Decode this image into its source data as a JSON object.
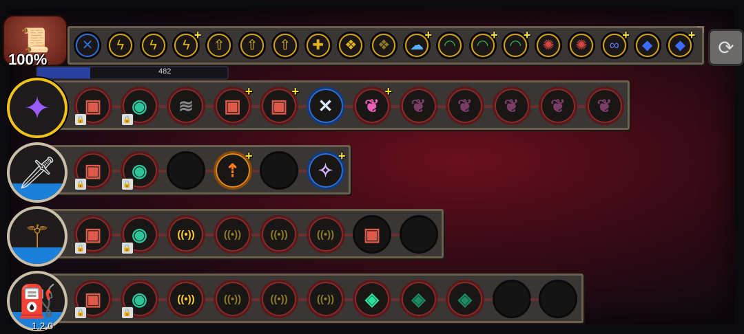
{
  "header": {
    "bag_percent": "100%",
    "xp_value": "482",
    "xp_progress": 0.28,
    "bag_icon": "scroll-bag-icon",
    "swap_icon": "refresh-icon"
  },
  "top_perks": [
    {
      "icon": "crossed-arrows-blue",
      "glyph": "✕",
      "color": "#2d6fd8",
      "plus": false
    },
    {
      "icon": "lightning-yellow",
      "glyph": "ϟ",
      "color": "#e0b31f",
      "plus": false
    },
    {
      "icon": "lightning-yellow",
      "glyph": "ϟ",
      "color": "#e0b31f",
      "plus": false
    },
    {
      "icon": "lightning-yellow-plus",
      "glyph": "ϟ",
      "color": "#e0b31f",
      "plus": true
    },
    {
      "icon": "arrow-up-yellow",
      "glyph": "⇧",
      "color": "#e0b31f",
      "plus": false
    },
    {
      "icon": "arrow-up-yellow",
      "glyph": "⇧",
      "color": "#e0b31f",
      "plus": false
    },
    {
      "icon": "arrow-up-yellow",
      "glyph": "⇧",
      "color": "#e0b31f",
      "plus": false
    },
    {
      "icon": "cross-rune-yellow",
      "glyph": "✚",
      "color": "#e0b31f",
      "plus": false
    },
    {
      "icon": "shield-rune-yellow",
      "glyph": "❖",
      "color": "#e0b31f",
      "plus": false
    },
    {
      "icon": "shield-rune-dim",
      "glyph": "❖",
      "color": "#8d7a2a",
      "plus": false
    },
    {
      "icon": "ghost-blue-plus",
      "glyph": "☁",
      "color": "#5ab3ff",
      "plus": true
    },
    {
      "icon": "green-arc",
      "glyph": "◠",
      "color": "#39c14e",
      "plus": false
    },
    {
      "icon": "green-arc-plus",
      "glyph": "◠",
      "color": "#39c14e",
      "plus": true
    },
    {
      "icon": "green-arc-plus",
      "glyph": "◠",
      "color": "#39c14e",
      "plus": true
    },
    {
      "icon": "red-swirl",
      "glyph": "✺",
      "color": "#d84646",
      "plus": false
    },
    {
      "icon": "red-swirl",
      "glyph": "✺",
      "color": "#d84646",
      "plus": false
    },
    {
      "icon": "infinity-plus",
      "glyph": "∞",
      "color": "#5d7bf0",
      "plus": true
    },
    {
      "icon": "blue-diamond",
      "glyph": "◆",
      "color": "#3b6cff",
      "plus": false
    },
    {
      "icon": "blue-diamond-plus",
      "glyph": "◆",
      "color": "#3b6cff",
      "plus": true
    }
  ],
  "weapons": [
    {
      "name": "crystal-weapon",
      "icon_glyph": "✦",
      "icon_color": "#9a5cff",
      "selected": true,
      "water": false,
      "slots": [
        {
          "icon": "red-box-locked",
          "glyph": "▣",
          "color": "#e05a4a",
          "ring": "red",
          "lock": true,
          "plus": false
        },
        {
          "icon": "green-orb-locked",
          "glyph": "◉",
          "color": "#2ec49a",
          "ring": "red",
          "lock": true,
          "plus": false
        },
        {
          "icon": "claw-marks",
          "glyph": "≋",
          "color": "#888888",
          "ring": "red",
          "lock": false,
          "plus": false
        },
        {
          "icon": "red-box-plus",
          "glyph": "▣",
          "color": "#e05a4a",
          "ring": "red",
          "lock": false,
          "plus": true
        },
        {
          "icon": "red-box-plus",
          "glyph": "▣",
          "color": "#e05a4a",
          "ring": "red",
          "lock": false,
          "plus": true
        },
        {
          "icon": "crossed-arrows-blue",
          "glyph": "✕",
          "color": "#d8e6ff",
          "ring": "blue",
          "lock": false,
          "plus": false
        },
        {
          "icon": "pink-leaf-plus",
          "glyph": "❦",
          "color": "#e85fb5",
          "ring": "red",
          "lock": false,
          "plus": true
        },
        {
          "icon": "purple-leaf",
          "glyph": "❦",
          "color": "#7a3d66",
          "ring": "red",
          "lock": false,
          "plus": false
        },
        {
          "icon": "purple-leaf",
          "glyph": "❦",
          "color": "#7a3d66",
          "ring": "red",
          "lock": false,
          "plus": false
        },
        {
          "icon": "purple-leaf",
          "glyph": "❦",
          "color": "#7a3d66",
          "ring": "red",
          "lock": false,
          "plus": false
        },
        {
          "icon": "purple-leaf",
          "glyph": "❦",
          "color": "#7a3d66",
          "ring": "red",
          "lock": false,
          "plus": false
        },
        {
          "icon": "purple-leaf",
          "glyph": "❦",
          "color": "#7a3d66",
          "ring": "red",
          "lock": false,
          "plus": false
        }
      ]
    },
    {
      "name": "sword-weapon",
      "icon_glyph": "🗡",
      "icon_color": "#dddddd",
      "selected": false,
      "water": true,
      "slots": [
        {
          "icon": "red-box-locked",
          "glyph": "▣",
          "color": "#e05a4a",
          "ring": "red",
          "lock": true,
          "plus": false
        },
        {
          "icon": "green-orb-locked",
          "glyph": "◉",
          "color": "#2ec49a",
          "ring": "red",
          "lock": true,
          "plus": false
        },
        {
          "icon": "empty",
          "glyph": "",
          "color": "#000000",
          "ring": "empty",
          "lock": false,
          "plus": false
        },
        {
          "icon": "orange-split-arrows-plus",
          "glyph": "⇡",
          "color": "#ff7a1a",
          "ring": "orange",
          "lock": false,
          "plus": true
        },
        {
          "icon": "empty",
          "glyph": "",
          "color": "#000000",
          "ring": "empty",
          "lock": false,
          "plus": false
        },
        {
          "icon": "purple-sparkle-plus",
          "glyph": "✧",
          "color": "#d4b8ff",
          "ring": "blue",
          "lock": false,
          "plus": true
        }
      ]
    },
    {
      "name": "staff-weapon",
      "icon_glyph": "⚚",
      "icon_color": "#d9902a",
      "selected": false,
      "water": true,
      "slots": [
        {
          "icon": "red-box-locked",
          "glyph": "▣",
          "color": "#e05a4a",
          "ring": "red",
          "lock": true,
          "plus": false
        },
        {
          "icon": "green-orb-locked",
          "glyph": "◉",
          "color": "#2ec49a",
          "ring": "red",
          "lock": true,
          "plus": false
        },
        {
          "icon": "signal-bright",
          "glyph": "((•))",
          "color": "#ffcc33",
          "ring": "red",
          "lock": false,
          "plus": false
        },
        {
          "icon": "signal-dim",
          "glyph": "((•))",
          "color": "#8c7a2a",
          "ring": "red",
          "lock": false,
          "plus": false
        },
        {
          "icon": "signal-dim",
          "glyph": "((•))",
          "color": "#8c7a2a",
          "ring": "red",
          "lock": false,
          "plus": false
        },
        {
          "icon": "signal-dim",
          "glyph": "((•))",
          "color": "#8c7a2a",
          "ring": "red",
          "lock": false,
          "plus": false
        },
        {
          "icon": "red-box",
          "glyph": "▣",
          "color": "#e05a4a",
          "ring": "empty",
          "lock": false,
          "plus": false
        },
        {
          "icon": "empty",
          "glyph": "",
          "color": "#000000",
          "ring": "empty",
          "lock": false,
          "plus": false
        }
      ]
    },
    {
      "name": "cannon-weapon",
      "icon_glyph": "⛽",
      "icon_color": "#9aa0a8",
      "selected": false,
      "water": true,
      "slots": [
        {
          "icon": "red-box-locked",
          "glyph": "▣",
          "color": "#e05a4a",
          "ring": "red",
          "lock": true,
          "plus": false
        },
        {
          "icon": "green-orb-locked",
          "glyph": "◉",
          "color": "#2ec49a",
          "ring": "red",
          "lock": true,
          "plus": false
        },
        {
          "icon": "signal-bright",
          "glyph": "((•))",
          "color": "#ffcc33",
          "ring": "red",
          "lock": false,
          "plus": false
        },
        {
          "icon": "signal-dim",
          "glyph": "((•))",
          "color": "#8c7a2a",
          "ring": "red",
          "lock": false,
          "plus": false
        },
        {
          "icon": "signal-dim",
          "glyph": "((•))",
          "color": "#8c7a2a",
          "ring": "red",
          "lock": false,
          "plus": false
        },
        {
          "icon": "signal-dim",
          "glyph": "((•))",
          "color": "#8c7a2a",
          "ring": "red",
          "lock": false,
          "plus": false
        },
        {
          "icon": "green-gem",
          "glyph": "◈",
          "color": "#2ee0a0",
          "ring": "red",
          "lock": false,
          "plus": false
        },
        {
          "icon": "green-gem-dim",
          "glyph": "◈",
          "color": "#1c8a62",
          "ring": "red",
          "lock": false,
          "plus": false
        },
        {
          "icon": "green-gem-dim",
          "glyph": "◈",
          "color": "#1c8a62",
          "ring": "red",
          "lock": false,
          "plus": false
        },
        {
          "icon": "empty",
          "glyph": "",
          "color": "#000000",
          "ring": "empty",
          "lock": false,
          "plus": false
        },
        {
          "icon": "empty",
          "glyph": "",
          "color": "#000000",
          "ring": "empty",
          "lock": false,
          "plus": false
        }
      ]
    }
  ],
  "version": "1.2.0"
}
